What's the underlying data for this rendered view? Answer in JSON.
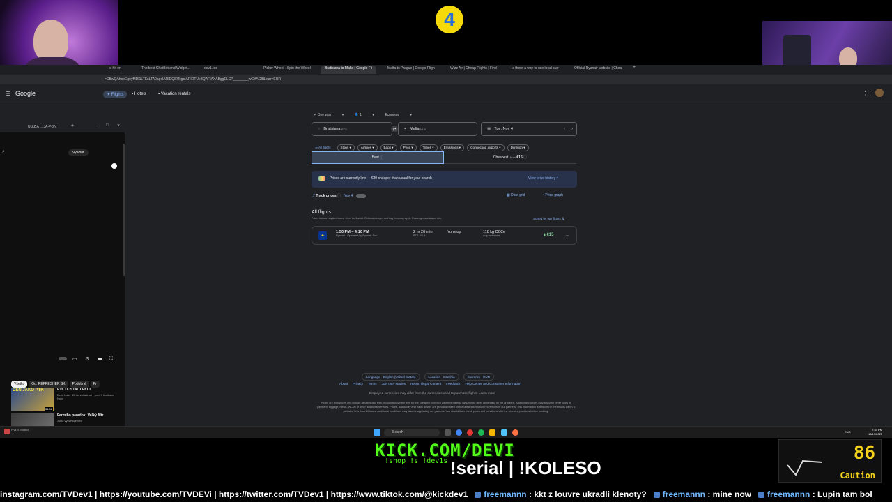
{
  "overlay": {
    "logo": "4",
    "kick_url": "KICK.COM/DEVI",
    "kick_sub": "!shop !s !dev1s",
    "commands": "!serial | !KOLESO",
    "gauge_value": "86",
    "gauge_label": "Caution",
    "ticker": {
      "links": "instagram.com/TVDev1 | https://youtube.com/TVDEVi | https://twitter.com/TVDev1 | https://www.tiktok.com/@kickdev1",
      "messages": [
        {
          "user": "freemannn",
          "text": " : kkt z louvre ukradli klenoty?"
        },
        {
          "user": "freemannn",
          "text": " : mine now"
        },
        {
          "user": "freemannn",
          "text": " : Lupin tam bol"
        }
      ]
    }
  },
  "browser": {
    "tabs": [
      "to hit en",
      "The best ChatBot and Widget...",
      "dev1.loo",
      "Picker Wheel · Spin the Wheel",
      "Bratislava to Malta | Google Fli",
      "Malta to Prague | Google Fligh",
      "Wizz Air | Cheap Flights | Find",
      "Is there a way to use local curr",
      "Official Ryanair website | Chea"
    ],
    "url": "=CBwQAhoeEgoyMDI1LTExLTA0agcIARIDQlRTcgcIARIDTUxBQAFIAXABggELCP________wGYACB&curr=EUR",
    "google_logo": "Google",
    "nav_tabs": [
      "Flights",
      "Hotels",
      "Vacation rentals"
    ]
  },
  "popup": {
    "tab_title": "U-ZZ A ... JA-PON",
    "create_label": "Vytvoriť",
    "chips": [
      "Všetko",
      "Od: REFRESHER SK",
      "Podobné",
      "Pr"
    ],
    "videos": [
      {
        "title": "PTK DOSTAL LEKCI",
        "meta": "Dezit Luis · 15 tis. zhliadnutí · pred 3 hodinami · Nové",
        "duration": "34:08",
        "thumb_text": "DEN JAKO PTK"
      },
      {
        "title": "Fermiho paradox: Veľký filtr",
        "meta": "Jsiha vysvetluje věci",
        "duration": "",
        "thumb_text": ""
      }
    ],
    "status": "Prvá cl. väčšino"
  },
  "flights": {
    "trip_type": "One way",
    "passengers": "1",
    "cabin": "Economy",
    "origin": "Bratislava",
    "origin_code": "BTS",
    "destination": "Malta",
    "destination_code": "MLA",
    "date": "Tue, Nov 4",
    "filters": [
      "All filters",
      "Stops",
      "Airlines",
      "Bags",
      "Price",
      "Times",
      "Emissions",
      "Connecting airports",
      "Duration"
    ],
    "sort_best": "Best",
    "sort_cheapest": "Cheapest",
    "cheapest_from": "from",
    "cheapest_price": "€15",
    "insight_text": "Prices are currently low — €39 cheaper than usual for your search",
    "view_history": "View price history",
    "track_prices": "Track prices",
    "track_date": "Nov 4",
    "date_grid": "Date grid",
    "price_graph": "Price graph",
    "all_flights": "All flights",
    "prices_note": "Prices include required taxes + fees for 1 adult. Optional charges and bag fees may apply. Passenger assistance info.",
    "sorted_by": "Sorted by top flights",
    "result": {
      "times": "1:50 PM – 4:10 PM",
      "airline": "Ryanair · Operated by Ryanair Sun",
      "duration": "2 hr 20 min",
      "route": "BTS–MLA",
      "stops": "Nonstop",
      "emissions": "118 kg CO2e",
      "emissions_note": "Avg emissions",
      "price": "€15"
    }
  },
  "footer": {
    "language": "Language · English (United States)",
    "location": "Location · Czechia",
    "currency": "Currency · EUR",
    "links": [
      "About",
      "Privacy",
      "Terms",
      "Join user studies",
      "Report illegal Content",
      "Feedback",
      "Help Center and Consumer Information"
    ],
    "currency_note": "Displayed currencies may differ from the currencies used to purchase flights. Learn more",
    "disclaimer": "Prices are final prices and include all taxes and fees, including payment fees for the cheapest common payment method (which may differ depending on the provider). Additional charges may apply for other types of payment, luggage, meals, WLAN or other additional services. Prices, availability and travel details are provided based on the latest information received from our partners. This information is reflected in the results within a period of less than 24 hours. Additional conditions may also be applied by our partners. You should then check prices and conditions with the services providers before booking."
  },
  "taskbar": {
    "search_placeholder": "Search",
    "lang": "ENG",
    "time": "7:44 PM",
    "date": "10/19/2025"
  }
}
